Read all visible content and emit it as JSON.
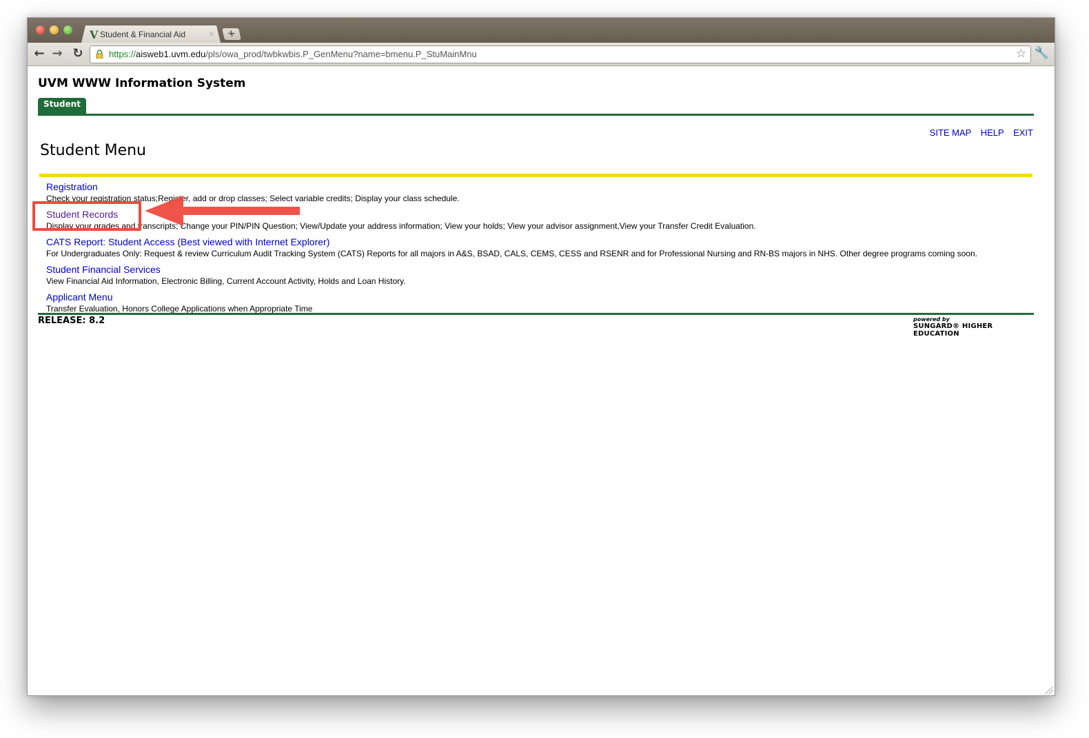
{
  "browser": {
    "tab_title": "Student & Financial Aid",
    "tab_favicon": "V",
    "tab_close": "×",
    "new_tab": "+",
    "url_scheme": "https://",
    "url_host": "aisweb1.uvm.edu",
    "url_path": "/pls/owa_prod/twbkwbis.P_GenMenu?name=bmenu.P_StuMainMnu",
    "icons": {
      "back": "back-arrow-icon",
      "forward": "forward-arrow-icon",
      "reload": "reload-icon",
      "lock": "lock-icon",
      "bookmark": "star-icon",
      "settings": "wrench-icon"
    }
  },
  "header": {
    "system_title": "UVM WWW Information System",
    "tab_label": "Student",
    "links": [
      "SITE MAP",
      "HELP",
      "EXIT"
    ]
  },
  "main": {
    "title": "Student Menu",
    "items": [
      {
        "label": "Registration",
        "description": "Check your registration status;Register, add or drop classes; Select variable credits; Display your class schedule."
      },
      {
        "label": "Student Records",
        "description": "Display your grades and transcripts; Change your PIN/PIN Question; View/Update your address information; View your holds; View your advisor assignment,View your Transfer Credit Evaluation."
      },
      {
        "label": "CATS Report: Student Access (Best viewed with Internet Explorer)",
        "description": "For Undergraduates Only: Request & review Curriculum Audit Tracking System (CATS) Reports for all majors in A&S, BSAD, CALS, CEMS, CESS and RSENR and for Professional Nursing and RN-BS majors in NHS. Other degree programs coming soon."
      },
      {
        "label": "Student Financial Services",
        "description": "View Financial Aid Information, Electronic Billing, Current Account Activity, Holds and Loan History."
      },
      {
        "label": "Applicant Menu",
        "description": "Transfer Evaluation, Honors College Applications when Appropriate Time"
      }
    ]
  },
  "footer": {
    "release": "RELEASE: 8.2",
    "powered_by": "powered by",
    "brand": "SUNGARD® HIGHER EDUCATION"
  },
  "colors": {
    "uvm_green": "#1f6b3a",
    "accent_yellow": "#f5d90b",
    "link_blue": "#0000cc",
    "visited_purple": "#551a8b",
    "annotation_red": "#ef4b3f"
  }
}
